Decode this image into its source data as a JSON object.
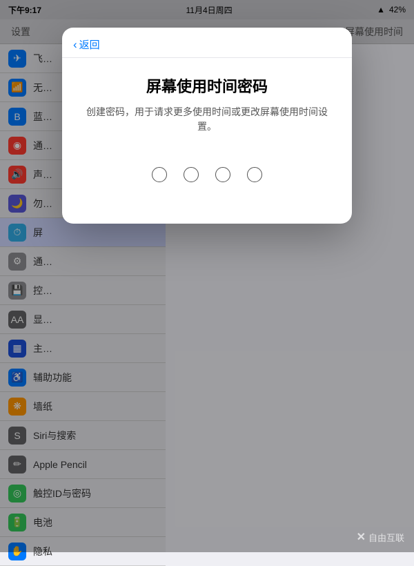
{
  "statusBar": {
    "time": "下午9:17",
    "date": "11月4日周四",
    "wifi": "WiFi",
    "battery": "42%"
  },
  "headerBar": {
    "leftLabel": "设置",
    "rightLabel": "屏幕使用时间"
  },
  "sidebar": {
    "items": [
      {
        "icon": "✈",
        "iconClass": "blue",
        "label": "飞…"
      },
      {
        "icon": "📶",
        "iconClass": "blue",
        "label": "无…"
      },
      {
        "icon": "B",
        "iconClass": "blue",
        "label": "蓝…"
      },
      {
        "icon": "◉",
        "iconClass": "red",
        "label": "通…"
      },
      {
        "icon": "🔊",
        "iconClass": "red",
        "label": "声…"
      },
      {
        "icon": "🌙",
        "iconClass": "indigo",
        "label": "勿…"
      },
      {
        "icon": "⏱",
        "iconClass": "teal",
        "label": "屏",
        "active": true
      },
      {
        "icon": "⚙",
        "iconClass": "gray",
        "label": "通…"
      },
      {
        "icon": "💾",
        "iconClass": "gray",
        "label": "控…"
      },
      {
        "icon": "AA",
        "iconClass": "dark-gray",
        "label": "显…"
      },
      {
        "icon": "▦",
        "iconClass": "dark-blue",
        "label": "主…"
      },
      {
        "icon": "♿",
        "iconClass": "blue",
        "label": "辅助功能"
      },
      {
        "icon": "❋",
        "iconClass": "orange",
        "label": "墙纸"
      },
      {
        "icon": "S",
        "iconClass": "dark-gray",
        "label": "Siri与搜索"
      },
      {
        "icon": "✏",
        "iconClass": "dark-gray",
        "label": "Apple Pencil"
      },
      {
        "icon": "◎",
        "iconClass": "green",
        "label": "触控ID与密码"
      },
      {
        "icon": "🔋",
        "iconClass": "green",
        "label": "电池"
      },
      {
        "icon": "✋",
        "iconClass": "blue",
        "label": "隐私"
      }
    ]
  },
  "modal": {
    "backLabel": "返回",
    "title": "屏幕使用时间密码",
    "subtitle": "创建密码，用于请求更多使用时间或更改屏幕使用时间设置。",
    "pinDots": 4
  },
  "watermark": {
    "symbol": "✕",
    "text": "自由互联"
  }
}
